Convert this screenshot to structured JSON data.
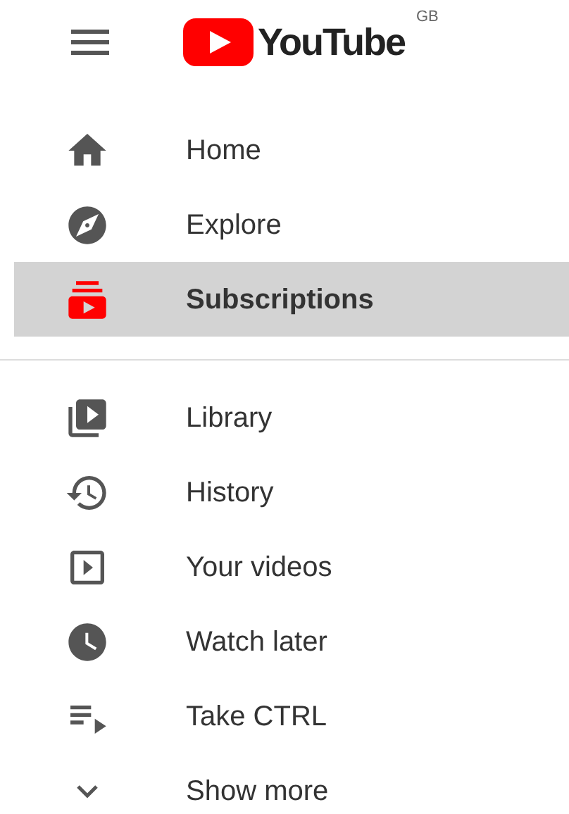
{
  "logo": {
    "name": "YouTube",
    "region": "GB"
  },
  "sections": [
    {
      "items": [
        {
          "label": "Home",
          "selected": false
        },
        {
          "label": "Explore",
          "selected": false
        },
        {
          "label": "Subscriptions",
          "selected": true
        }
      ]
    },
    {
      "items": [
        {
          "label": "Library",
          "selected": false
        },
        {
          "label": "History",
          "selected": false
        },
        {
          "label": "Your videos",
          "selected": false
        },
        {
          "label": "Watch later",
          "selected": false
        },
        {
          "label": "Take CTRL",
          "selected": false
        },
        {
          "label": "Show more",
          "selected": false
        }
      ]
    }
  ]
}
